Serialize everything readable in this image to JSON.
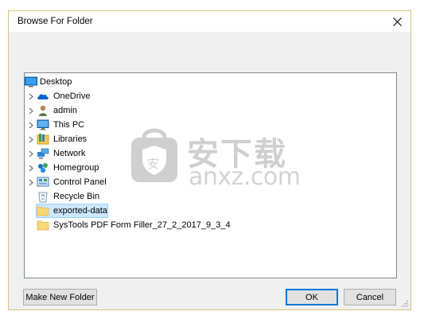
{
  "window": {
    "title": "Browse For Folder",
    "accent_color": "#0078d7",
    "selection_color": "#cce8ff"
  },
  "tree": {
    "root": {
      "label": "Desktop",
      "icon": "desktop-icon"
    },
    "items": [
      {
        "label": "OneDrive",
        "icon": "cloud-icon",
        "expandable": true
      },
      {
        "label": "admin",
        "icon": "user-icon",
        "expandable": true
      },
      {
        "label": "This PC",
        "icon": "computer-icon",
        "expandable": true
      },
      {
        "label": "Libraries",
        "icon": "library-icon",
        "expandable": true
      },
      {
        "label": "Network",
        "icon": "network-icon",
        "expandable": true
      },
      {
        "label": "Homegroup",
        "icon": "homegroup-icon",
        "expandable": true
      },
      {
        "label": "Control Panel",
        "icon": "control-panel-icon",
        "expandable": true
      },
      {
        "label": "Recycle Bin",
        "icon": "recycle-bin-icon",
        "expandable": false
      },
      {
        "label": "exported-data",
        "icon": "folder-icon",
        "expandable": false,
        "selected": true
      },
      {
        "label": "SysTools PDF Form Filler_27_2_2017_9_3_4",
        "icon": "folder-icon",
        "expandable": false
      }
    ]
  },
  "buttons": {
    "make_new_folder": "Make New Folder",
    "ok": "OK",
    "cancel": "Cancel"
  },
  "watermark": {
    "cn_text": "安下载",
    "site_text": "anxz.com",
    "shield_char": "安"
  }
}
